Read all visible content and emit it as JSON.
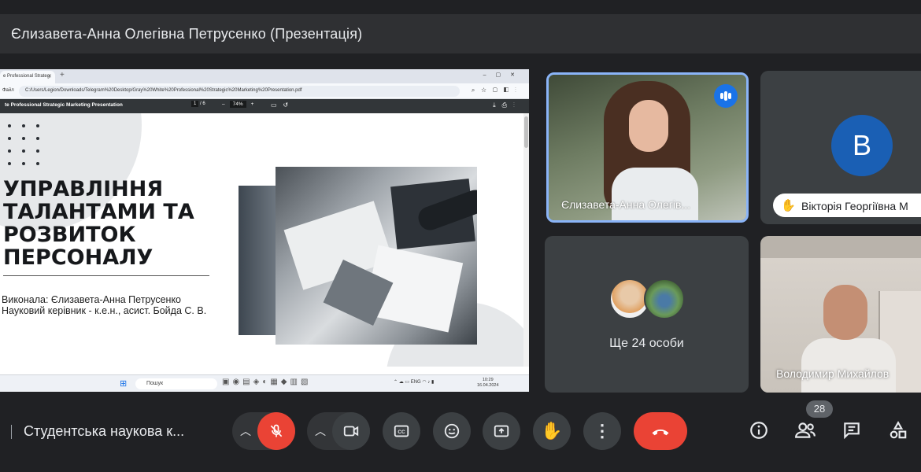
{
  "header": {
    "title": "Єлизавета-Анна Олегівна Петрусенко (Презентація)"
  },
  "browser": {
    "tab_title": "te Professional Strategic Marketing Presentation",
    "tab_label_short": "e Professional Strateg",
    "address_info": "Файл",
    "url": "C:/Users/Legion/Downloads/Telegram%20Desktop/Gray%20White%20Professional%20Strategic%20Marketing%20Presentation.pdf",
    "pdf_title": "te Professional Strategic Marketing Presentation",
    "page_current": "1",
    "page_total": "/ 6",
    "zoom": "74%"
  },
  "slide": {
    "title": "УПРАВЛІННЯ ТАЛАНТАМИ ТА РОЗВИТОК ПЕРСОНАЛУ",
    "author_line": "Виконала: Єлизавета-Анна Петрусенко",
    "supervisor_line": "Науковий керівник - к.е.н., асист. Бойда С. В."
  },
  "taskbar": {
    "search_placeholder": "Пошук",
    "lang": "ENG",
    "time": "10:29",
    "date": "16.04.2024"
  },
  "participants": {
    "speaker_name": "Єлизавета-Анна Олегів...",
    "viktoria_initial": "B",
    "viktoria_name": "Вікторія Георгіївна М",
    "more_label": "Ще 24 особи",
    "volodymyr_name": "Володимир Михайлов"
  },
  "controls": {
    "meeting_title": "Студентська наукова к...",
    "participants_count": "28"
  },
  "colors": {
    "background": "#202124",
    "tile": "#3c4043",
    "accent_blue": "#8ab4f8",
    "danger_red": "#ea4335",
    "avatar_blue": "#1a5fb4"
  }
}
